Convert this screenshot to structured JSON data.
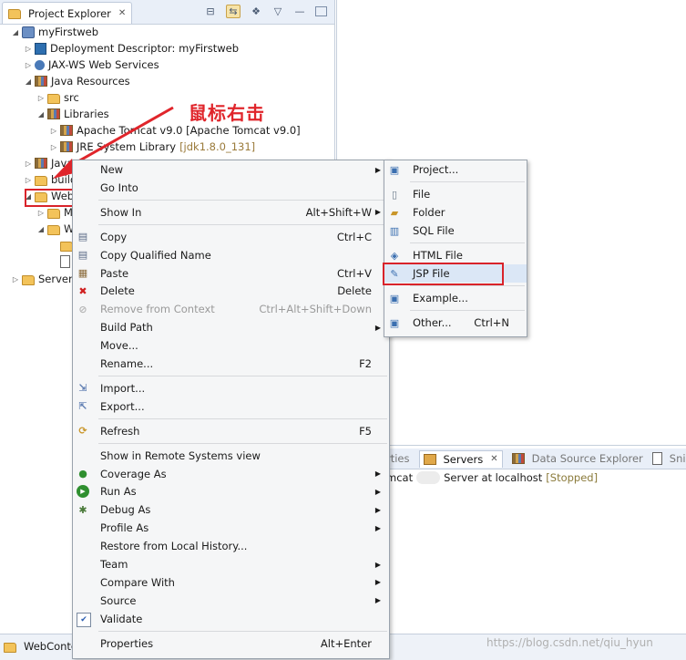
{
  "project_explorer": {
    "tab_label": "Project Explorer",
    "tab_close": "✕",
    "tree": [
      {
        "label": "myFirstweb",
        "icon": "project-icon",
        "twisty": "◢",
        "indent": 0
      },
      {
        "label": "Deployment Descriptor: myFirstweb",
        "icon": "deployment-descriptor-icon",
        "twisty": "▷",
        "indent": 1
      },
      {
        "label": "JAX-WS Web Services",
        "icon": "web-services-icon",
        "twisty": "▷",
        "indent": 1
      },
      {
        "label": "Java Resources",
        "icon": "java-resources-icon",
        "twisty": "◢",
        "indent": 1
      },
      {
        "label": "src",
        "icon": "package-folder-icon",
        "twisty": "▷",
        "indent": 2
      },
      {
        "label": "Libraries",
        "icon": "libraries-icon",
        "twisty": "◢",
        "indent": 2
      },
      {
        "label": "Apache Tomcat v9.0 [Apache Tomcat v9.0]",
        "icon": "library-icon",
        "twisty": "▷",
        "indent": 3
      },
      {
        "label": "JRE System Library",
        "suffix": "[jdk1.8.0_131]",
        "icon": "library-icon",
        "twisty": "▷",
        "indent": 3
      },
      {
        "label": "Java",
        "icon": "java-resources-icon",
        "twisty": "▷",
        "indent": 1
      },
      {
        "label": "build",
        "icon": "folder-icon",
        "twisty": "▷",
        "indent": 1
      },
      {
        "label": "Web",
        "icon": "folder-icon",
        "twisty": "◢",
        "indent": 1
      },
      {
        "label": "M",
        "icon": "folder-icon",
        "twisty": "▷",
        "indent": 2
      },
      {
        "label": "W",
        "icon": "folder-icon",
        "twisty": "◢",
        "indent": 2
      },
      {
        "label": "",
        "icon": "folder-icon",
        "twisty": "",
        "indent": 3
      },
      {
        "label": "",
        "icon": "xml-file-icon",
        "twisty": "",
        "indent": 3
      },
      {
        "label": "Servers",
        "icon": "servers-folder-icon",
        "twisty": "▷",
        "indent": 0
      }
    ]
  },
  "annotation": {
    "text": "鼠标右击"
  },
  "context_menu": {
    "items": [
      {
        "label": "New",
        "submenu": true
      },
      {
        "label": "Go Into"
      },
      {
        "sep": true
      },
      {
        "label": "Show In",
        "accel": "Alt+Shift+W",
        "submenu": true
      },
      {
        "sep": true
      },
      {
        "label": "Copy",
        "accel": "Ctrl+C",
        "icon": "copy-icon"
      },
      {
        "label": "Copy Qualified Name",
        "icon": "copy-qualified-name-icon"
      },
      {
        "label": "Paste",
        "accel": "Ctrl+V",
        "icon": "paste-icon"
      },
      {
        "label": "Delete",
        "accel": "Delete",
        "icon": "delete-icon"
      },
      {
        "label": "Remove from Context",
        "accel": "Ctrl+Alt+Shift+Down",
        "icon": "remove-context-icon",
        "disabled": true
      },
      {
        "label": "Build Path",
        "submenu": true
      },
      {
        "label": "Move..."
      },
      {
        "label": "Rename...",
        "accel": "F2"
      },
      {
        "sep": true
      },
      {
        "label": "Import...",
        "icon": "import-icon"
      },
      {
        "label": "Export...",
        "icon": "export-icon"
      },
      {
        "sep": true
      },
      {
        "label": "Refresh",
        "accel": "F5",
        "icon": "refresh-icon"
      },
      {
        "sep": true
      },
      {
        "label": "Show in Remote Systems view"
      },
      {
        "label": "Coverage As",
        "submenu": true,
        "icon": "coverage-icon"
      },
      {
        "label": "Run As",
        "submenu": true,
        "icon": "run-icon"
      },
      {
        "label": "Debug As",
        "submenu": true,
        "icon": "debug-icon"
      },
      {
        "label": "Profile As",
        "submenu": true
      },
      {
        "label": "Restore from Local History..."
      },
      {
        "label": "Team",
        "submenu": true
      },
      {
        "label": "Compare With",
        "submenu": true
      },
      {
        "label": "Source",
        "submenu": true
      },
      {
        "label": "Validate",
        "icon": "validate-checkbox-icon"
      },
      {
        "sep": true
      },
      {
        "label": "Properties",
        "accel": "Alt+Enter"
      }
    ]
  },
  "new_submenu": {
    "items": [
      {
        "label": "Project...",
        "icon": "new-project-icon"
      },
      {
        "sep": true
      },
      {
        "label": "File",
        "icon": "new-file-icon"
      },
      {
        "label": "Folder",
        "icon": "new-folder-icon"
      },
      {
        "label": "SQL File",
        "icon": "sql-file-icon"
      },
      {
        "sep": true
      },
      {
        "label": "HTML File",
        "icon": "html-file-icon"
      },
      {
        "label": "JSP File",
        "icon": "jsp-file-icon",
        "selected": true
      },
      {
        "sep": true
      },
      {
        "label": "Example...",
        "icon": "example-icon"
      },
      {
        "sep": true
      },
      {
        "label": "Other...",
        "accel": "Ctrl+N",
        "icon": "other-wizard-icon"
      }
    ]
  },
  "bottom_view": {
    "tabs": [
      {
        "label": "rties",
        "active": false
      },
      {
        "label": "Servers",
        "active": true,
        "close": "✕"
      },
      {
        "label": "Data Source Explorer",
        "active": false
      },
      {
        "label": "Snippets",
        "active": false
      }
    ],
    "server_entry": {
      "prefix": "mcat",
      "label": "Server at localhost",
      "state": "[Stopped]"
    }
  },
  "status_bar": {
    "tab_label": "WebConte"
  },
  "watermark": "https://blog.csdn.net/qiu_hyun"
}
